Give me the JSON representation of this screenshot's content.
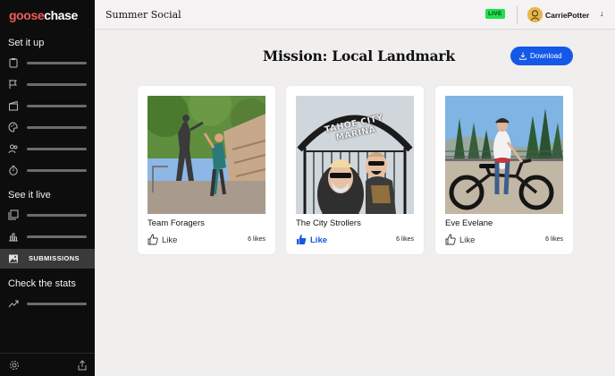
{
  "brand": {
    "logo_part1": "goose",
    "logo_part2": "chase"
  },
  "sidebar": {
    "sections": [
      {
        "title": "Set it up"
      },
      {
        "title": "See it live"
      },
      {
        "title": "Check the stats"
      }
    ],
    "active_item": {
      "label": "SUBMISSIONS"
    }
  },
  "header": {
    "game_title": "Summer Social",
    "live_badge": "LIVE",
    "username": "CarriePotter",
    "user_menu_caret": "↓"
  },
  "main": {
    "mission_title": "Mission: Local Landmark",
    "download_label": "Download",
    "submissions": [
      {
        "name": "Team Foragers",
        "like_label": "Like",
        "likes": "6 likes",
        "liked": false
      },
      {
        "name": "The City Strollers",
        "like_label": "Like",
        "likes": "6 likes",
        "liked": true
      },
      {
        "name": "Eve Evelane",
        "like_label": "Like",
        "likes": "6 likes",
        "liked": false
      }
    ],
    "photo_sign_text": "TAHOE CITY MARINA"
  },
  "colors": {
    "accent": "#1458e8",
    "live": "#1fe04d",
    "sidebar_bg": "#0d0d0d",
    "logo_red": "#f05a5a"
  }
}
